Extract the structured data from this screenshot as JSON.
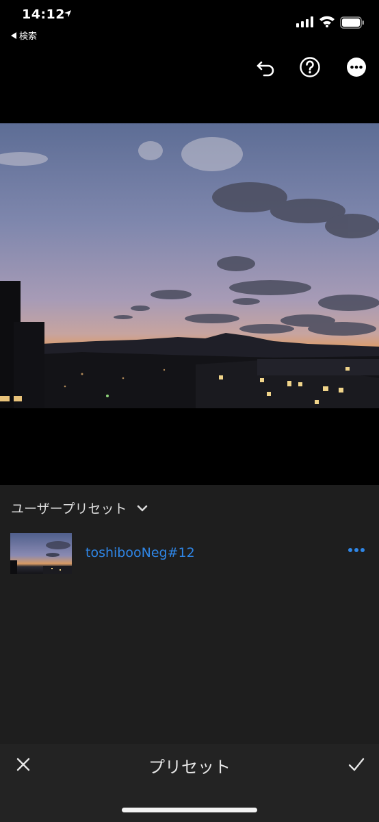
{
  "status_bar": {
    "time": "14:12",
    "back_label": "検索"
  },
  "toolbar": {
    "undo_icon": "undo-icon",
    "help_icon": "help-icon",
    "more_icon": "more-icon"
  },
  "preset_panel": {
    "group_label": "ユーザープリセット",
    "items": [
      {
        "name": "toshibooNeg#12"
      }
    ]
  },
  "bottom_bar": {
    "title": "プリセット"
  },
  "colors": {
    "accent": "#2f86e6",
    "panel_bg": "#1e1e1e",
    "bottom_bg": "#232323"
  }
}
